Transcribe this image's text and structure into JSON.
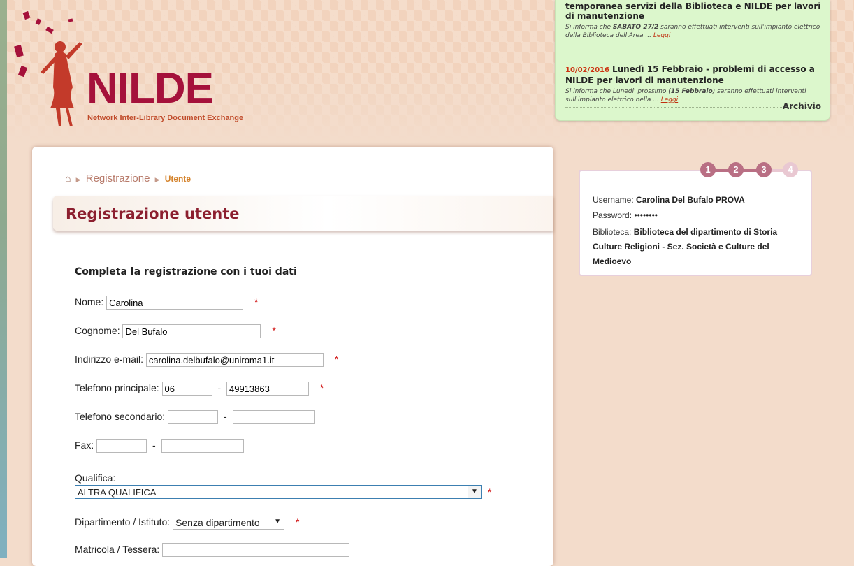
{
  "colors": {
    "brand": "#a5113b",
    "accent": "#d4822a",
    "title": "#8c1f2f",
    "news_bg": "#dcf7cc",
    "required": "#d01010"
  },
  "header": {
    "logo": "NILDE",
    "tagline": "Network Inter-Library Document Exchange"
  },
  "news": {
    "items": [
      {
        "date": "",
        "title": "temporanea servizi della Biblioteca e NILDE per lavori di manutenzione",
        "text_before": "Si informa che ",
        "text_bold": "SABATO 27/2",
        "text_after": " saranno effettuati interventi sull'impianto elettrico della Biblioteca dell'Area ...",
        "link": "Leggi"
      },
      {
        "date": "10/02/2016",
        "title": "Lunedì 15 Febbraio - problemi di accesso a NILDE per lavori di manutenzione",
        "text_before": "Si informa che Lunedi' prossimo (",
        "text_bold": "15 Febbraio",
        "text_after": ") saranno effettuati interventi sull'impianto elettrico nella ...",
        "link": "Leggi"
      }
    ],
    "archive_label": "Archivio"
  },
  "breadcrumb": {
    "home_icon": "home-icon",
    "item1": "Registrazione",
    "current": "Utente"
  },
  "page_title": "Registrazione utente",
  "form": {
    "subtitle": "Completa la registrazione con i tuoi dati",
    "required_mark": "*",
    "dash": "-",
    "nome": {
      "label": "Nome:",
      "value": "Carolina"
    },
    "cognome": {
      "label": "Cognome:",
      "value": "Del Bufalo"
    },
    "email": {
      "label": "Indirizzo e-mail:",
      "value": "carolina.delbufalo@uniroma1.it"
    },
    "tel1": {
      "label": "Telefono principale:",
      "prefix": "06",
      "number": "49913863"
    },
    "tel2": {
      "label": "Telefono secondario:",
      "prefix": "",
      "number": ""
    },
    "fax": {
      "label": "Fax:",
      "prefix": "",
      "number": ""
    },
    "qualifica": {
      "label": "Qualifica:",
      "value": "ALTRA QUALIFICA"
    },
    "dipartimento": {
      "label": "Dipartimento / Istituto:",
      "value": "Senza dipartimento"
    },
    "matricola": {
      "label": "Matricola / Tessera:",
      "value": ""
    }
  },
  "steps": [
    "1",
    "2",
    "3",
    "4"
  ],
  "summary": {
    "username_label": "Username:",
    "username": "Carolina Del Bufalo PROVA",
    "password_label": "Password:",
    "password": "••••••••",
    "biblioteca_label": "Biblioteca:",
    "biblioteca": "Biblioteca del dipartimento di Storia Culture Religioni - Sez. Società e Culture del Medioevo"
  }
}
